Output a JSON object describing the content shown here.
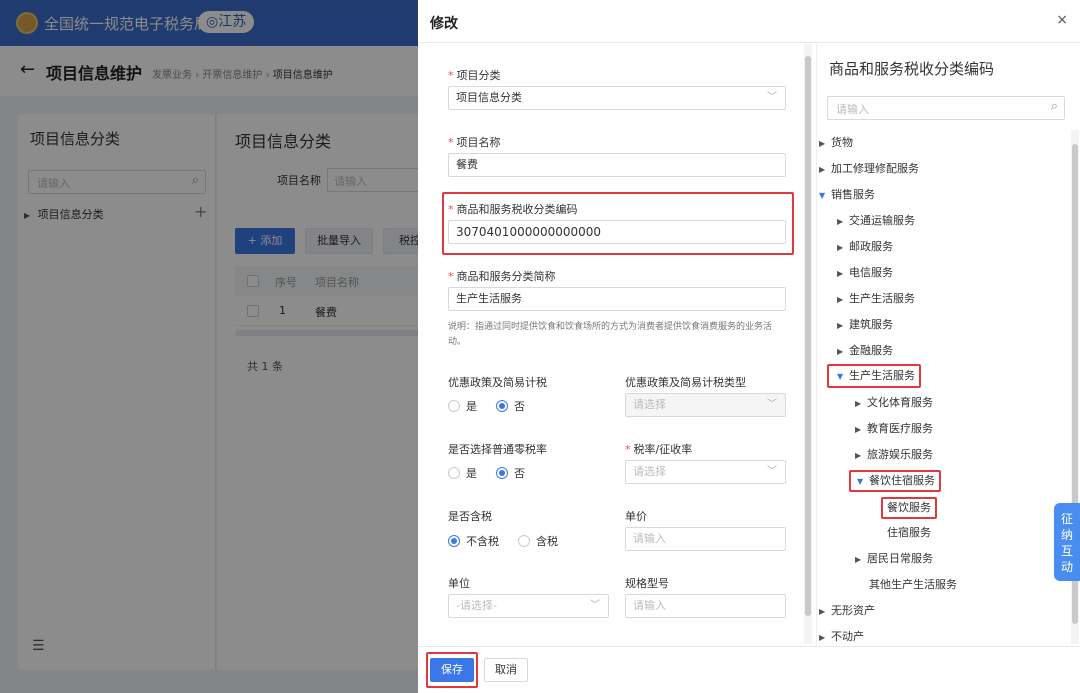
{
  "background": {
    "brand": "全国统一规范电子税务局",
    "region": "◎江苏",
    "page_title": "项目信息维护",
    "breadcrumb": [
      "发票业务",
      "开票信息维护",
      "项目信息维护"
    ],
    "left": {
      "title": "项目信息分类",
      "search_placeholder": "请输入",
      "tree_root": "项目信息分类"
    },
    "main": {
      "title": "项目信息分类",
      "filter_label": "项目名称",
      "filter_placeholder": "请输入",
      "btn_add": "+ 添加",
      "btn_import": "批量导入",
      "btn_tax": "税控",
      "col_no": "序号",
      "col_name": "项目名称",
      "row_no": "1",
      "row_name": "餐费",
      "total": "共 1 条"
    }
  },
  "modal": {
    "title": "修改",
    "close": "×",
    "fields": {
      "category_label": "项目分类",
      "category_value": "项目信息分类",
      "name_label": "项目名称",
      "name_value": "餐费",
      "code_label": "商品和服务税收分类编码",
      "code_value": "3070401000000000000",
      "short_label": "商品和服务分类简称",
      "short_value": "生产生活服务",
      "note": "说明：指通过同时提供饮食和饮食场所的方式为消费者提供饮食消费服务的业务活动。",
      "pref_label": "优惠政策及简易计税",
      "pref_yes": "是",
      "pref_no": "否",
      "pref_type_label": "优惠政策及简易计税类型",
      "pref_type_placeholder": "请选择",
      "zero_label": "是否选择普通零税率",
      "zero_yes": "是",
      "zero_no": "否",
      "rate_label": "税率/征收率",
      "rate_placeholder": "请选择",
      "taxinc_label": "是否含税",
      "taxinc_excl": "不含税",
      "taxinc_incl": "含税",
      "price_label": "单价",
      "price_placeholder": "请输入",
      "unit_label": "单位",
      "unit_placeholder": "-请选择-",
      "spec_label": "规格型号",
      "spec_placeholder": "请输入"
    },
    "footer": {
      "save": "保存",
      "cancel": "取消"
    },
    "tree": {
      "title": "商品和服务税收分类编码",
      "search_placeholder": "请输入",
      "nodes": [
        "货物",
        "加工修理修配服务",
        "销售服务",
        "交通运输服务",
        "邮政服务",
        "电信服务",
        "生产生活服务",
        "建筑服务",
        "金融服务",
        "生产生活服务",
        "文化体育服务",
        "教育医疗服务",
        "旅游娱乐服务",
        "餐饮住宿服务",
        "餐饮服务",
        "住宿服务",
        "居民日常服务",
        "其他生产生活服务",
        "无形资产",
        "不动产"
      ]
    }
  },
  "float_tab": "征纳互动",
  "colors": {
    "primary": "#3a78e8",
    "header": "#3a6ccb",
    "highlight": "#e0383e"
  }
}
